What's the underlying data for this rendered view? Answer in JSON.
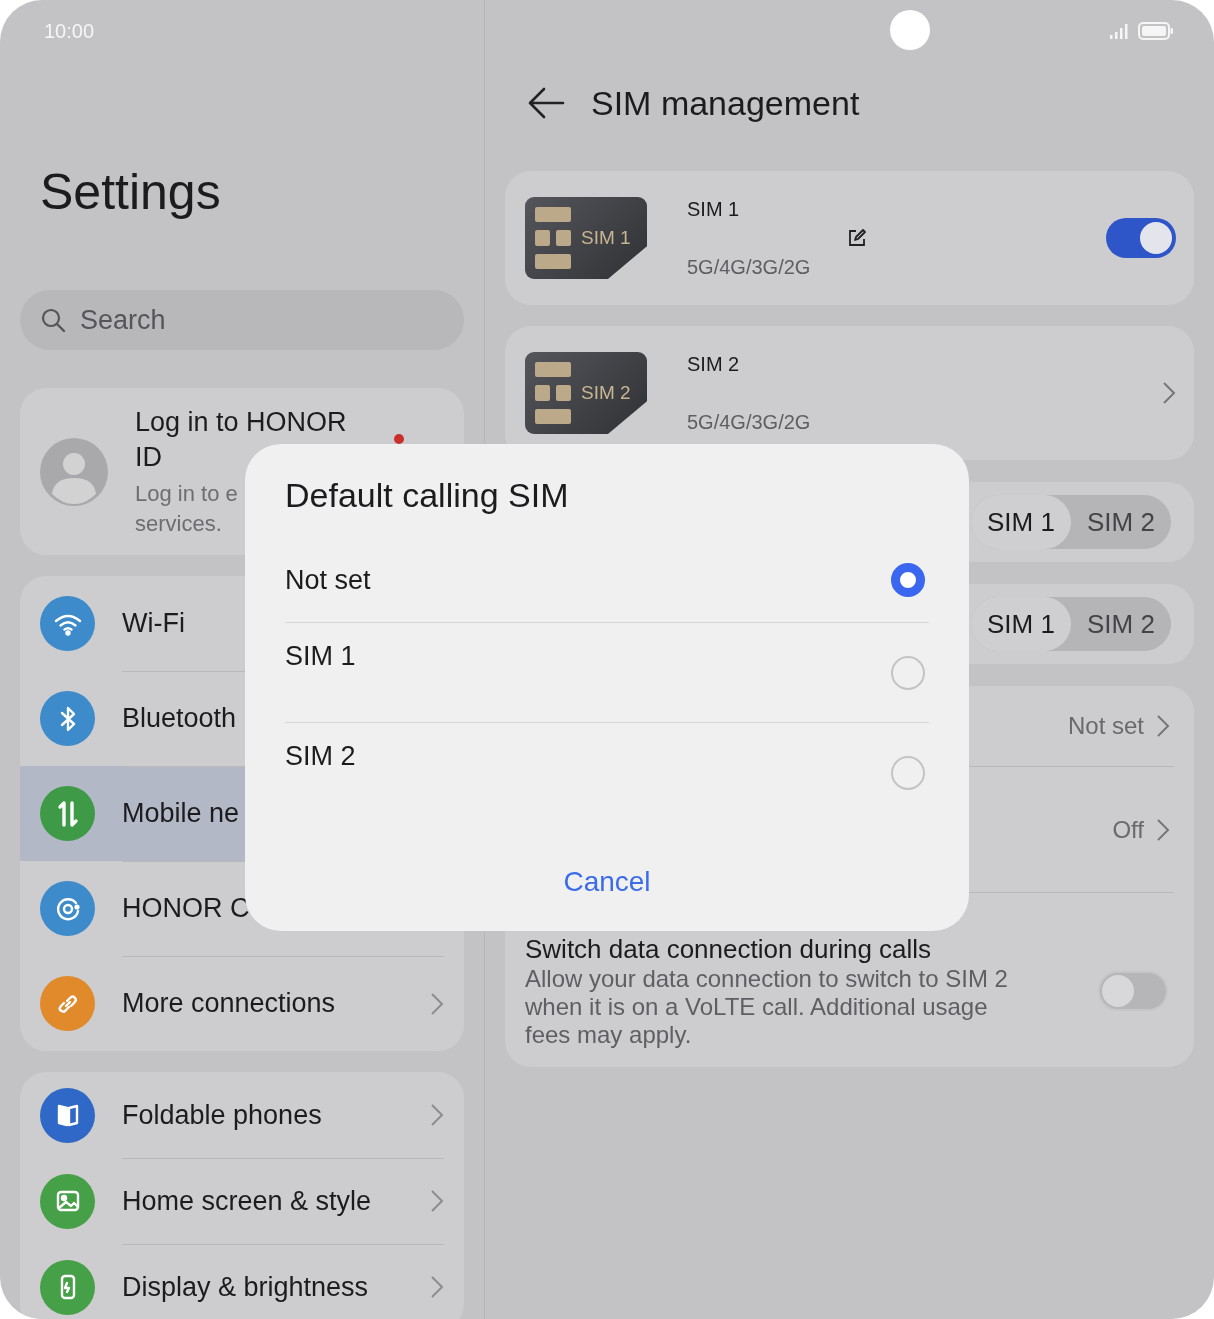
{
  "status_bar": {
    "time": "10:00"
  },
  "sidebar": {
    "title": "Settings",
    "search": {
      "placeholder": "Search"
    },
    "account": {
      "title_lines": [
        "Log in to HONOR",
        "ID"
      ],
      "subtitle_lines": [
        "Log in to e",
        "services."
      ],
      "badge": true
    },
    "groups": [
      {
        "items": [
          {
            "label": "Wi-Fi",
            "color": "#3d8bcb",
            "selected": false,
            "chevron": false
          },
          {
            "label": "Bluetooth",
            "color": "#3d8bcb",
            "selected": false,
            "chevron": false
          },
          {
            "label": "Mobile ne",
            "color": "#3f9a48",
            "selected": true,
            "chevron": false
          },
          {
            "label": "HONOR C",
            "color": "#3d8bcb",
            "selected": false,
            "chevron": false
          },
          {
            "label": "More connections",
            "color": "#e08a2c",
            "selected": false,
            "chevron": true
          }
        ]
      },
      {
        "items": [
          {
            "label": "Foldable phones",
            "color": "#2f68c6",
            "selected": false,
            "chevron": true
          },
          {
            "label": "Home screen & style",
            "color": "#45a048",
            "selected": false,
            "chevron": true
          },
          {
            "label": "Display & brightness",
            "color": "#45a048",
            "selected": false,
            "chevron": true
          }
        ]
      }
    ]
  },
  "page": {
    "title": "SIM management"
  },
  "sims": [
    {
      "card_label": "SIM 1",
      "name": "SIM 1",
      "network": "5G/4G/3G/2G",
      "editable": true,
      "kind": "toggle",
      "on": true
    },
    {
      "card_label": "SIM 2",
      "name": "SIM 2",
      "network": "5G/4G/3G/2G",
      "editable": false,
      "kind": "chevron"
    }
  ],
  "segment_cards": [
    {
      "options": [
        {
          "label": "SIM 1",
          "selected": true
        },
        {
          "label": "SIM 2",
          "selected": false
        }
      ]
    },
    {
      "options": [
        {
          "label": "SIM 1",
          "selected": true
        },
        {
          "label": "SIM 2",
          "selected": false
        }
      ]
    }
  ],
  "settings_card": {
    "rows": [
      {
        "kind": "value",
        "value": "Not set"
      },
      {
        "kind": "value",
        "value": "Off"
      },
      {
        "kind": "switch",
        "title": "Switch data connection during calls",
        "description": "Allow your data connection to switch to SIM 2 when it is on a VoLTE call. Additional usage fees may apply.",
        "on": false
      }
    ]
  },
  "dialog": {
    "title": "Default calling SIM",
    "options": [
      {
        "label": "Not set",
        "selected": true
      },
      {
        "label": "SIM 1",
        "selected": false
      },
      {
        "label": "SIM 2",
        "selected": false
      }
    ],
    "cancel": "Cancel"
  }
}
